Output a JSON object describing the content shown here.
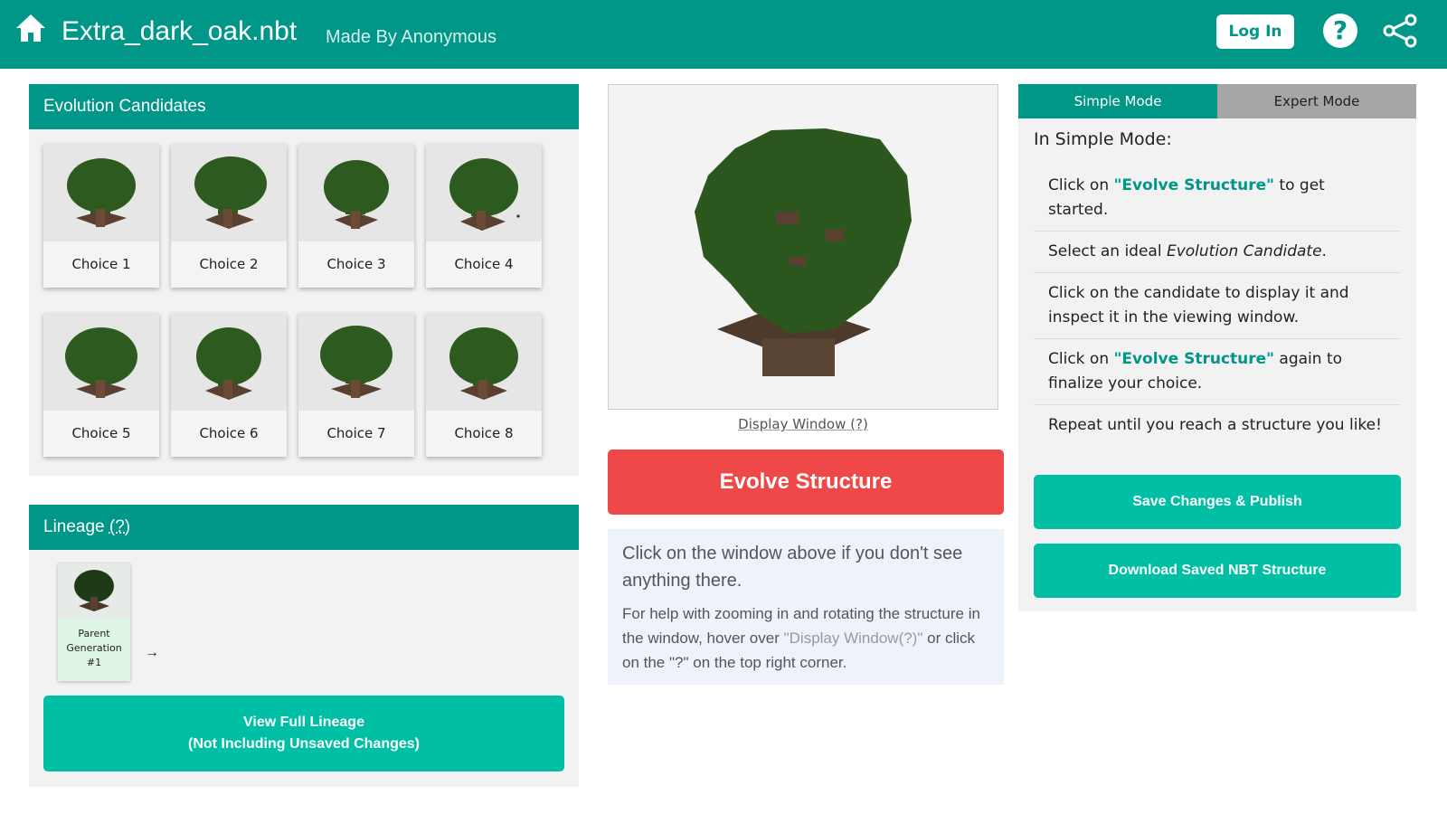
{
  "header": {
    "home_icon": "home-icon",
    "title": "Extra_dark_oak.nbt",
    "subtitle": "Made By Anonymous",
    "login_label": "Log In",
    "help_label": "?",
    "help_icon": "help-icon",
    "share_icon": "share-icon"
  },
  "candidates": {
    "title": "Evolution Candidates",
    "items": [
      {
        "label": "Choice 1"
      },
      {
        "label": "Choice 2"
      },
      {
        "label": "Choice 3"
      },
      {
        "label": "Choice 4"
      },
      {
        "label": "Choice 5"
      },
      {
        "label": "Choice 6"
      },
      {
        "label": "Choice 7"
      },
      {
        "label": "Choice 8"
      }
    ]
  },
  "lineage": {
    "title": "Lineage",
    "help": "(?)",
    "parent_line1": "Parent",
    "parent_line2": "Generation",
    "parent_line3": "#1",
    "arrow": "→",
    "button_line1": "View Full Lineage",
    "button_line2": "(Not Including Unsaved Changes)"
  },
  "display": {
    "caption": "Display Window (?)",
    "evolve_label": "Evolve Structure",
    "info_main": "Click on the window above if you don't see anything there.",
    "info_sub_pre": "For help with zooming in and rotating the structure in the window, hover over ",
    "info_sub_hl": "\"Display Window(?)\"",
    "info_sub_post": " or click on the \"?\" on the top right corner."
  },
  "modes": {
    "simple_label": "Simple Mode",
    "expert_label": "Expert Mode",
    "heading": "In Simple Mode:",
    "step1_pre": "Click on ",
    "step1_kw": "\"Evolve Structure\"",
    "step1_post": " to get started.",
    "step2_pre": "Select an ideal ",
    "step2_em": "Evolution Candidate",
    "step2_post": ".",
    "step3": "Click on the candidate to display it and inspect it in the viewing window.",
    "step4_pre": "Click on ",
    "step4_kw": "\"Evolve Structure\"",
    "step4_post": " again to finalize your choice.",
    "step5": "Repeat until you reach a structure you like!",
    "save_label": "Save Changes & Publish",
    "download_label": "Download Saved NBT Structure"
  },
  "colors": {
    "primary": "#009688",
    "accent": "#00bfa5",
    "evolve": "#ef4848",
    "foliage": "#2c5a1f",
    "trunk": "#5a4030"
  }
}
